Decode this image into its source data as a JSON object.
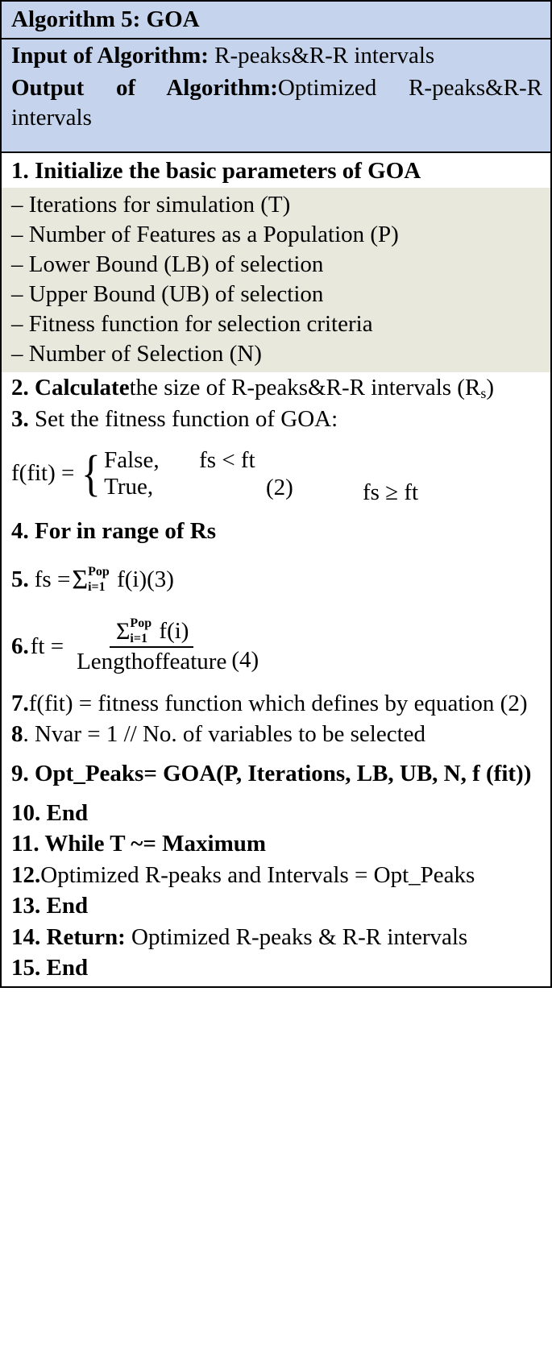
{
  "algorithm": {
    "title": "Algorithm 5: GOA",
    "io": {
      "input_label": "Input of Algorithm:",
      "input_value": "R-peaks&R-R intervals",
      "output_label": "Output of Algorithm:",
      "output_value": "Optimized R-peaks&R-R intervals"
    },
    "steps": {
      "step1": "1. Initialize the basic parameters of GOA",
      "bullets": [
        "– Iterations for simulation (T)",
        "– Number of Features as a Population (P)",
        "– Lower Bound (LB) of selection",
        "– Upper Bound (UB) of selection",
        "– Fitness function for selection criteria",
        "– Number of Selection (N)"
      ],
      "step2_num": "2.",
      "step2_bold": "Calculate",
      "step2_rest": "the size of R-peaks&R-R intervals (R",
      "step2_sub": "s",
      "step2_tail": ")",
      "step3_num": "3.",
      "step3_text": "Set the fitness function of GOA:",
      "eq2": {
        "lhs": "f(fit)  =",
        "case1_value": "False,",
        "case1_cond": "fs < ft",
        "case2_value": "True,",
        "case2_cond": "fs ≥ ft",
        "number": "(2)"
      },
      "step4": "4. For in range of Rs",
      "eq3": {
        "prefix_num": "5.",
        "prefix": "fs  =",
        "sigma": "Σ",
        "upper": "Pop",
        "lower": "i=1",
        "body": "f(i)",
        "number": "(3)"
      },
      "eq4": {
        "prefix_num": "6.",
        "prefix": "ft  =",
        "sigma": "Σ",
        "upper": "Pop",
        "lower": "i=1",
        "numerator_body": "f(i)",
        "denominator": "Lengthoffeature",
        "number": "(4)"
      },
      "step7_num": "7.",
      "step7_text": "f(fit) = fitness function which defines by equation (2)",
      "step8_num": "8",
      "step8_text": ". Nvar = 1 // No. of variables to be selected",
      "step9": "9. Opt_Peaks= GOA(P, Iterations, LB, UB, N, f (fit))",
      "step10": "10. End",
      "step11": "11. While T ~= Maximum",
      "step12_num": "12.",
      "step12_text": "Optimized R-peaks and Intervals = Opt_Peaks",
      "step13": "13. End",
      "step14_num": "14. Return:",
      "step14_text": "Optimized R-peaks & R-R intervals",
      "step15": "15. End"
    }
  },
  "colors": {
    "header_band": "#c5d4ec",
    "bullet_band": "#e9e8dd",
    "body": "#ffffff",
    "border": "#000000"
  }
}
